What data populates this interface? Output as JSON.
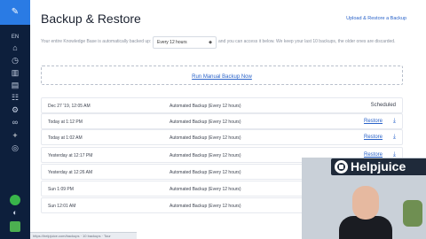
{
  "header": {
    "title": "Backup & Restore",
    "upload_link": "Upload & Restore a Backup"
  },
  "intro": {
    "text_before": "Your entire Knowledge Base is automatically backed up:",
    "frequency_value": "Every 12 hours",
    "text_after": "and you can access it below. We keep your last 10 backups, the older ones are discarded."
  },
  "manual_backup": {
    "label": "Run Manual Backup Now"
  },
  "rows": [
    {
      "date": "Dec 27 '19, 12:05 AM",
      "type": "Automated Backup (Every 12 hours)",
      "action": "Scheduled"
    },
    {
      "date": "Today at 1:12 PM",
      "type": "Automated Backup (Every 12 hours)",
      "action": "Restore"
    },
    {
      "date": "Today at 1:02 AM",
      "type": "Automated Backup (Every 12 hours)",
      "action": "Restore"
    },
    {
      "date": "Yesterday at 12:17 PM",
      "type": "Automated Backup (Every 12 hours)",
      "action": "Restore"
    },
    {
      "date": "Yesterday at 12:26 AM",
      "type": "Automated Backup (Every 12 hours)",
      "action": ""
    },
    {
      "date": "Sun 1:09 PM",
      "type": "Automated Backup (Every 12 hours)",
      "action": ""
    },
    {
      "date": "Sun 12:01 AM",
      "type": "Automated Backup (Every 12 hours)",
      "action": ""
    }
  ],
  "webcam": {
    "logo_text": "Helpjuice"
  },
  "statusbar": {
    "text": "https://helpjuice.com/backups · 10 backups · Tour"
  },
  "colors": {
    "sidebar": "#0d1f3c",
    "accent": "#2a7be4",
    "link": "#2a63c9"
  },
  "icons": [
    "edit-icon",
    "home-icon",
    "clock-icon",
    "chart-icon",
    "document-icon",
    "users-icon",
    "settings-icon",
    "globe-icon",
    "link-icon",
    "help-icon",
    "download-icon"
  ]
}
